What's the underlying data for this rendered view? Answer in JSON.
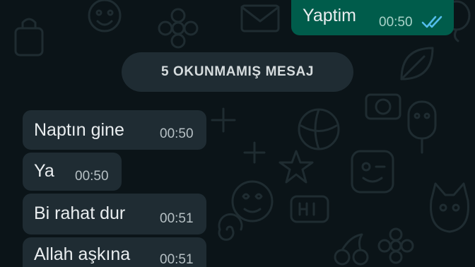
{
  "chat": {
    "outgoing": [
      {
        "text": "Yaptim",
        "time": "00:50",
        "status_icon": "double-check-read-icon"
      }
    ],
    "unread_banner": "5 OKUNMAMIŞ MESAJ",
    "incoming": [
      {
        "text": "Naptın gine",
        "time": "00:50"
      },
      {
        "text": "Ya",
        "time": "00:50"
      },
      {
        "text": "Bi rahat dur",
        "time": "00:51"
      },
      {
        "text": "Allah aşkına",
        "time": "00:51"
      }
    ]
  },
  "colors": {
    "background": "#0b1418",
    "incoming_bubble": "#1f2c33",
    "outgoing_bubble": "#005c4b",
    "read_ticks": "#53bdeb"
  }
}
